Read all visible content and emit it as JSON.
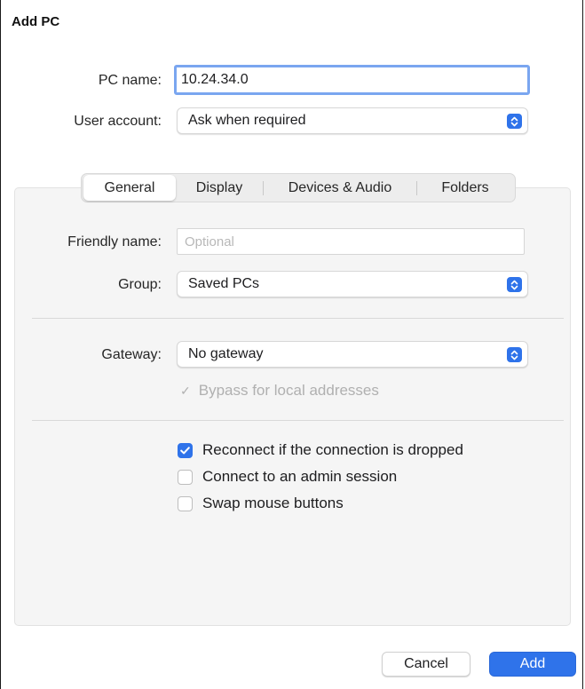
{
  "window": {
    "title": "Add PC"
  },
  "form": {
    "pc_name_label": "PC name:",
    "pc_name_value": "10.24.34.0",
    "user_account_label": "User account:",
    "user_account_value": "Ask when required"
  },
  "tabs": [
    {
      "label": "General",
      "active": true
    },
    {
      "label": "Display",
      "active": false
    },
    {
      "label": "Devices & Audio",
      "active": false
    },
    {
      "label": "Folders",
      "active": false
    }
  ],
  "general": {
    "friendly_name_label": "Friendly name:",
    "friendly_name_placeholder": "Optional",
    "group_label": "Group:",
    "group_value": "Saved PCs",
    "gateway_label": "Gateway:",
    "gateway_value": "No gateway",
    "bypass_label": "Bypass for local addresses",
    "bypass_checked": true,
    "bypass_enabled": false,
    "options": [
      {
        "label": "Reconnect if the connection is dropped",
        "checked": true
      },
      {
        "label": "Connect to an admin session",
        "checked": false
      },
      {
        "label": "Swap mouse buttons",
        "checked": false
      }
    ]
  },
  "buttons": {
    "cancel": "Cancel",
    "add": "Add"
  },
  "colors": {
    "accent": "#2f73ea",
    "focus_ring": "#7aa6f0",
    "panel_bg": "#f5f5f5"
  }
}
